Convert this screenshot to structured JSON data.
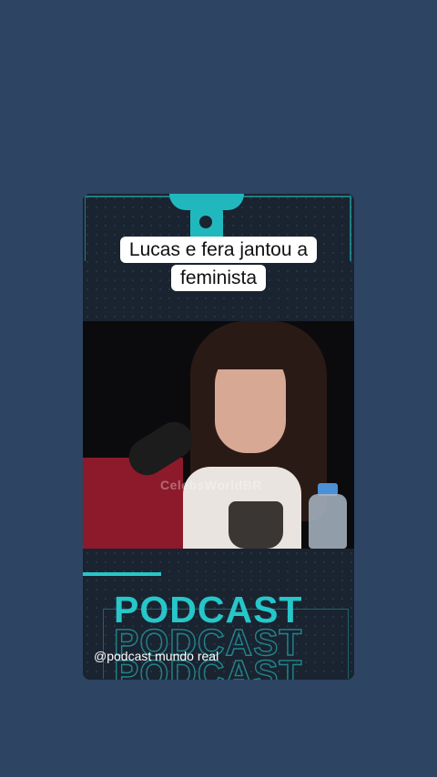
{
  "caption": {
    "text": "Lucas e fera jantou a feminista"
  },
  "video": {
    "watermark": "CelebsWorldBR"
  },
  "footer": {
    "title": "PODCAST",
    "handle": "@podcast mundo real"
  },
  "colors": {
    "background": "#2d4462",
    "accent": "#27c6c9",
    "card": "#141c26"
  }
}
